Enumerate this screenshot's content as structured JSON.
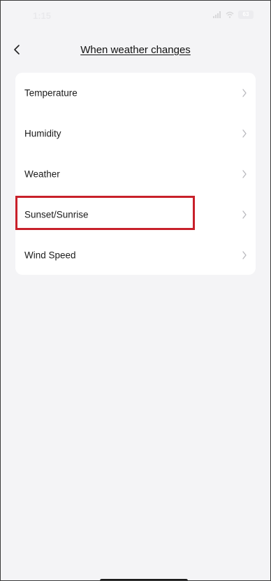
{
  "status_bar": {
    "time": "1:15",
    "battery": "63"
  },
  "header": {
    "title": "When weather changes",
    "back_icon": "chevron-left-icon"
  },
  "conditions": {
    "items": [
      {
        "label": "Temperature",
        "icon": "chevron-right-icon"
      },
      {
        "label": "Humidity",
        "icon": "chevron-right-icon"
      },
      {
        "label": "Weather",
        "icon": "chevron-right-icon"
      },
      {
        "label": "Sunset/Sunrise",
        "icon": "chevron-right-icon"
      },
      {
        "label": "Wind Speed",
        "icon": "chevron-right-icon"
      }
    ]
  },
  "colors": {
    "background": "#f4f4f6",
    "card": "#ffffff",
    "highlight": "#c8202a",
    "chevron": "#b8b8bd"
  }
}
